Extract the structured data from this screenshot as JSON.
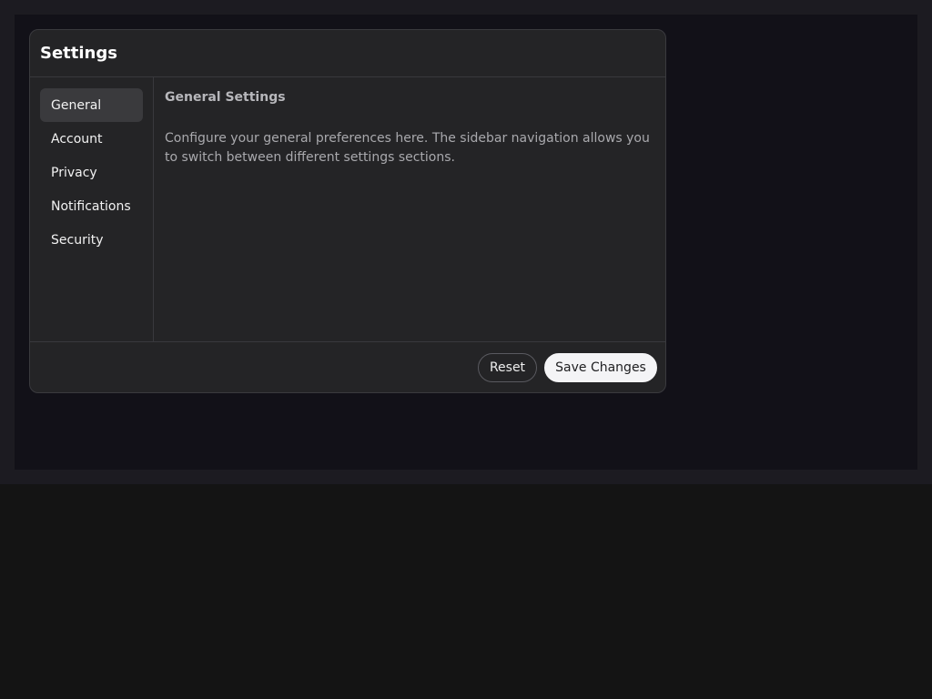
{
  "dialog": {
    "title": "Settings"
  },
  "sidebar": {
    "items": [
      {
        "label": "General",
        "active": true
      },
      {
        "label": "Account",
        "active": false
      },
      {
        "label": "Privacy",
        "active": false
      },
      {
        "label": "Notifications",
        "active": false
      },
      {
        "label": "Security",
        "active": false
      }
    ]
  },
  "content": {
    "heading": "General Settings",
    "description": "Configure your general preferences here. The sidebar navigation allows you to switch between different settings sections."
  },
  "footer": {
    "reset_label": "Reset",
    "save_label": "Save Changes"
  },
  "colors": {
    "page_background": "#141414",
    "dialog_background": "#242426",
    "active_item_background": "#3a3a3d",
    "primary_button_background": "#f4f4f6"
  }
}
